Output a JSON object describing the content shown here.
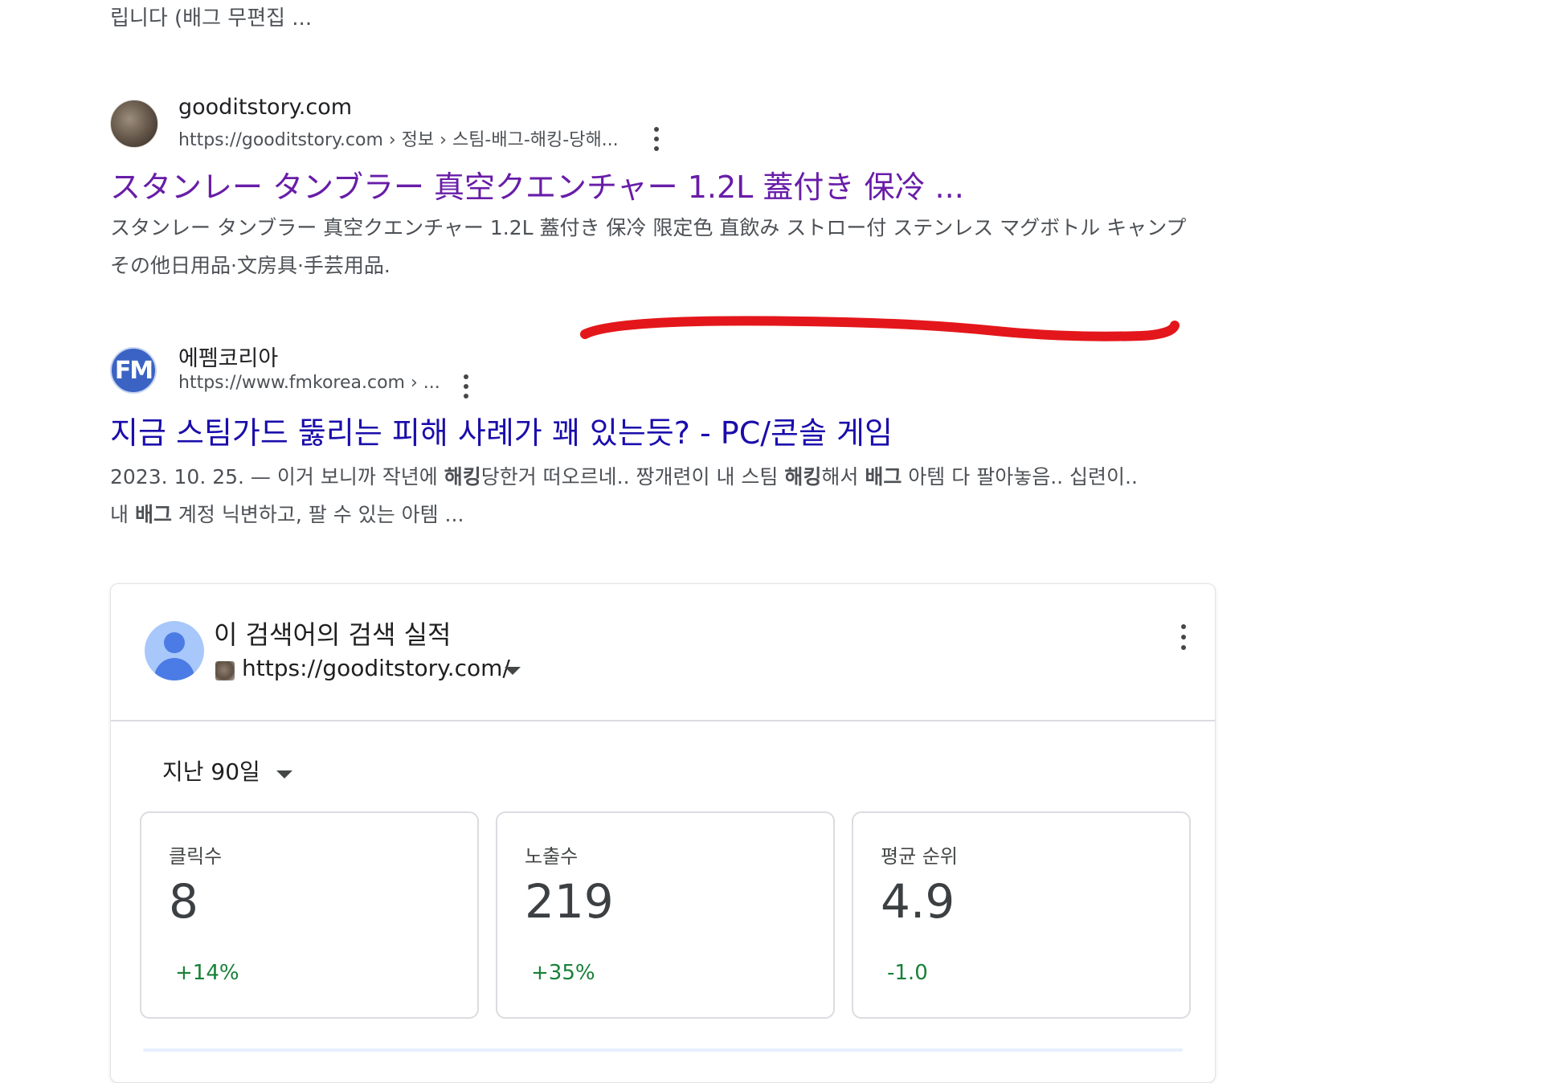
{
  "top_snippet": "립니다 (배그 무편집 ...",
  "results": [
    {
      "site_name": "gooditstory.com",
      "url": "https://gooditstory.com › 정보 › 스팀-배그-해킹-당해...",
      "title": "スタンレー タンブラー 真空クエンチャー 1.2L 蓋付き 保冷 ...",
      "snippet_line1": "スタンレー タンブラー 真空クエンチャー 1.2L 蓋付き 保冷 限定色 直飲み ストロー付 ステンレス マグボトル キャンプ",
      "snippet_line2": "その他日用品·文房具·手芸用品.",
      "favicon": "cat-photo-favicon",
      "title_color": "#681da8"
    },
    {
      "site_name": "에펨코리아",
      "url": "https://www.fmkorea.com › ...",
      "title": "지금 스팀가드 뚫리는 피해 사례가 꽤 있는듯? - PC/콘솔 게임",
      "snippet_line1_parts": [
        "2023. 10. 25. — 이거 보니까 작년에 ",
        "해킹",
        "당한거 떠오르네.. 짱개련이 내 스팀 ",
        "해킹",
        "해서 ",
        "배그",
        " 아템 다 팔아놓음.. 십련이.."
      ],
      "snippet_line2_parts": [
        "내 ",
        "배그",
        " 계정 닉변하고, 팔 수 있는 아템 ..."
      ],
      "favicon_text": "FM",
      "title_color": "#1a0dab"
    }
  ],
  "annotation": {
    "color": "#e3171b"
  },
  "performance_card": {
    "title": "이 검색어의 검색 실적",
    "property_url": "https://gooditstory.com/",
    "date_range": "지난 90일",
    "metrics": [
      {
        "label": "클릭수",
        "value": "8",
        "delta": "+14%"
      },
      {
        "label": "노출수",
        "value": "219",
        "delta": "+35%"
      },
      {
        "label": "평균 순위",
        "value": "4.9",
        "delta": "-1.0"
      }
    ],
    "delta_color": "#188038"
  }
}
